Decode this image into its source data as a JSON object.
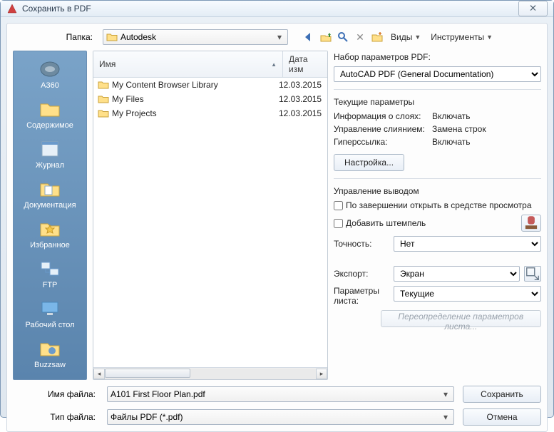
{
  "window": {
    "title": "Сохранить в PDF"
  },
  "toolbar": {
    "folder_label": "Папка:",
    "location_name": "Autodesk",
    "views_label": "Виды",
    "tools_label": "Инструменты"
  },
  "places": [
    {
      "label": "A360",
      "icon": "a360"
    },
    {
      "label": "Содержимое",
      "icon": "folder"
    },
    {
      "label": "Журнал",
      "icon": "journal"
    },
    {
      "label": "Документация",
      "icon": "docs"
    },
    {
      "label": "Избранное",
      "icon": "fav"
    },
    {
      "label": "FTP",
      "icon": "ftp"
    },
    {
      "label": "Рабочий стол",
      "icon": "desktop"
    },
    {
      "label": "Buzzsaw",
      "icon": "buzzsaw"
    }
  ],
  "filelist": {
    "col_name": "Имя",
    "col_date": "Дата изм",
    "rows": [
      {
        "name": "My Content Browser Library",
        "date": "12.03.2015"
      },
      {
        "name": "My Files",
        "date": "12.03.2015"
      },
      {
        "name": "My Projects",
        "date": "12.03.2015"
      }
    ]
  },
  "right": {
    "preset_heading": "Набор параметров PDF:",
    "preset_value": "AutoCAD PDF (General Documentation)",
    "current_heading": "Текущие параметры",
    "layer_info_label": "Информация о слоях:",
    "layer_info_value": "Включать",
    "merge_label": "Управление слиянием:",
    "merge_value": "Замена строк",
    "hyperlink_label": "Гиперссылка:",
    "hyperlink_value": "Включать",
    "settings_btn": "Настройка...",
    "output_heading": "Управление выводом",
    "open_viewer_label": "По завершении открыть в средстве просмотра",
    "add_stamp_label": "Добавить штемпель",
    "precision_label": "Точность:",
    "precision_value": "Нет",
    "export_label": "Экспорт:",
    "export_value": "Экран",
    "sheet_params_label": "Параметры листа:",
    "sheet_params_value": "Текущие",
    "override_btn": "Переопределение параметров листа..."
  },
  "bottom": {
    "filename_label": "Имя файла:",
    "filename_value": "A101 First Floor Plan.pdf",
    "filetype_label": "Тип файла:",
    "filetype_value": "Файлы PDF (*.pdf)",
    "save_btn": "Сохранить",
    "cancel_btn": "Отмена"
  }
}
